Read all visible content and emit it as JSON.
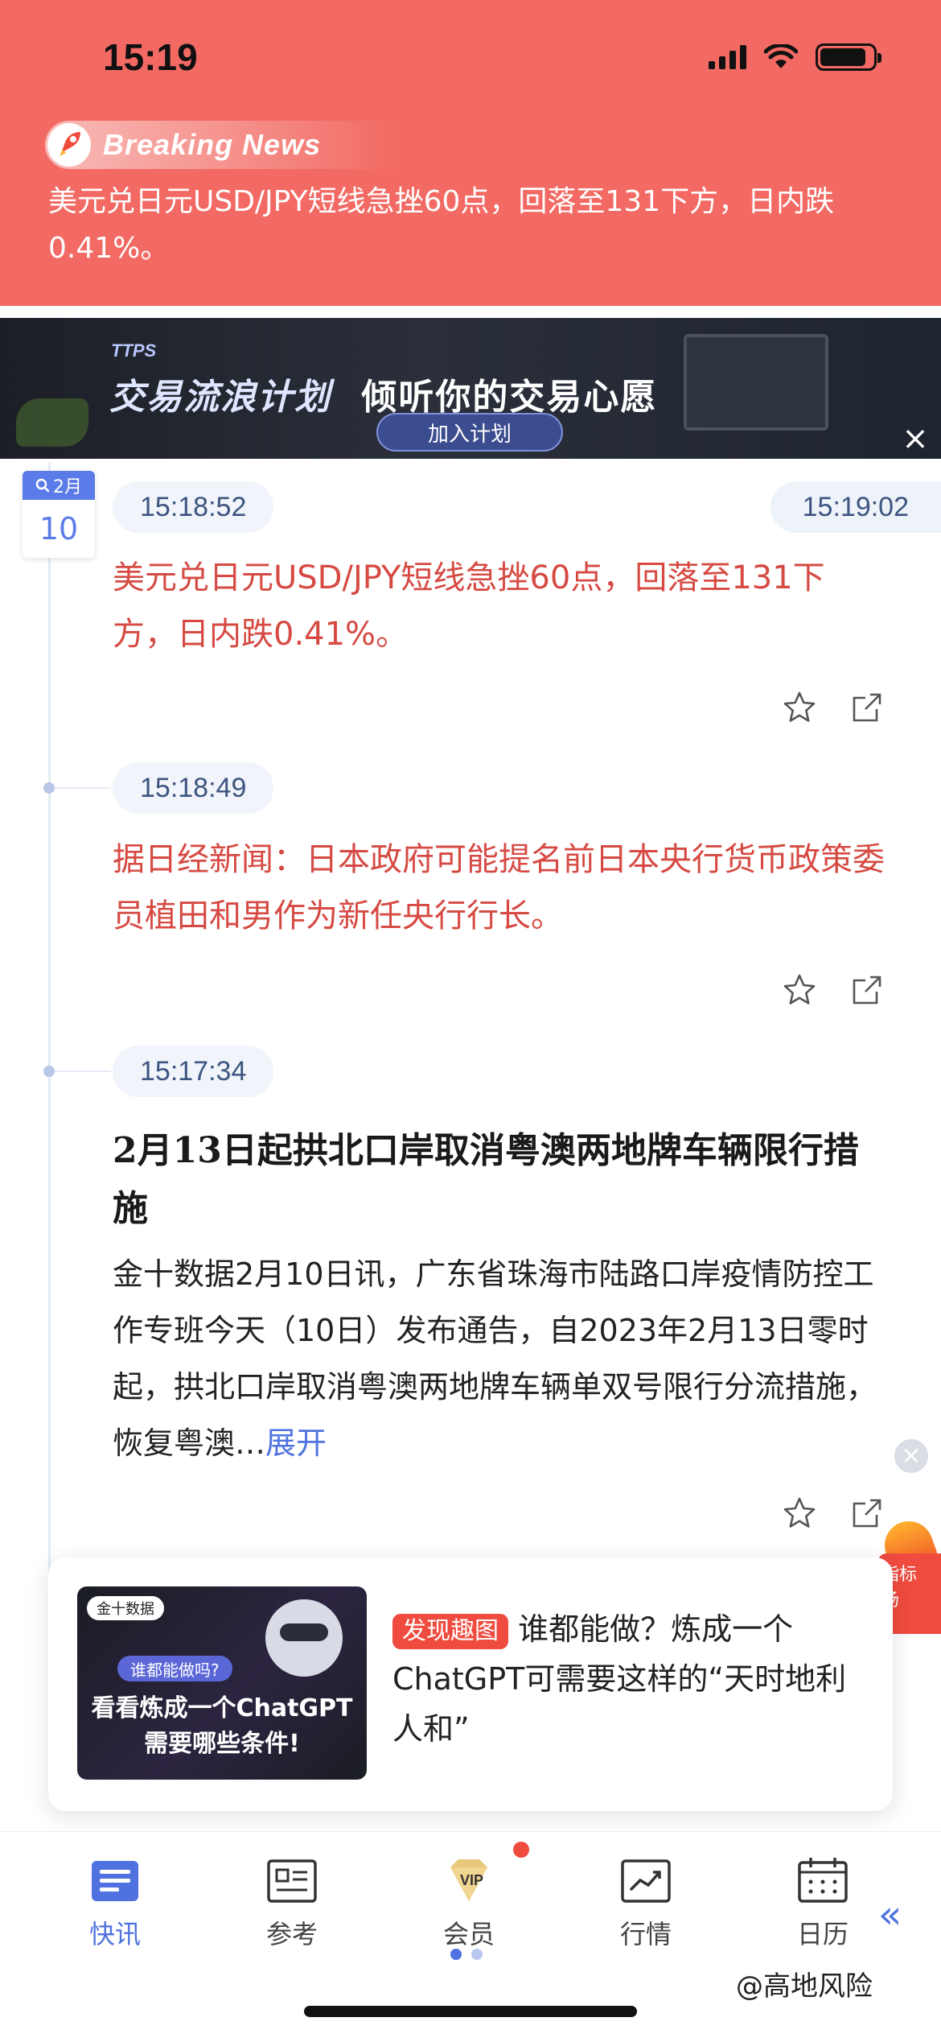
{
  "status_bar": {
    "time": "15:19"
  },
  "breaking": {
    "badge": "Breaking News",
    "text": "美元兑日元USD/JPY短线急挫60点，回落至131下方，日内跌0.41%。"
  },
  "ad": {
    "sub": "TTPS",
    "title_1": "交易流浪计划",
    "title_2": "倾听你的交易心愿",
    "cta": "加入计划",
    "close": "×"
  },
  "date_badge": {
    "month": "2月",
    "day": "10"
  },
  "feed": {
    "latest_time": "15:19:02",
    "items": [
      {
        "time": "15:18:52",
        "text": "美元兑日元USD/JPY短线急挫60点，回落至131下方，日内跌0.41%。"
      },
      {
        "time": "15:18:49",
        "text": "据日经新闻：日本政府可能提名前日本央行货币政策委员植田和男作为新任央行行长。"
      },
      {
        "time": "15:17:34",
        "title": "2月13日起拱北口岸取消粤澳两地牌车辆限行措施",
        "body": "金十数据2月10日讯，广东省珠海市陆路口岸疫情防控工作专班今天（10日）发布通告，自2023年2月13日零时起，拱北口岸取消粤澳两地牌车辆单双号限行分流措施，恢复粤澳…",
        "expand": "展开"
      }
    ]
  },
  "promo": {
    "thumb_brand": "金十数据",
    "thumb_question": "谁都能做吗?",
    "thumb_line1": "看看炼成一个ChatGPT",
    "thumb_line2": "需要哪些条件!",
    "tag": "发现趣图",
    "text": "谁都能做？炼成一个ChatGPT可需要这样的“天时地利人和”"
  },
  "side_hot": {
    "label": "指标 场"
  },
  "tabs": [
    {
      "label": "快讯",
      "icon": "news-list-icon",
      "active": true
    },
    {
      "label": "参考",
      "icon": "reference-card-icon",
      "active": false
    },
    {
      "label": "会员",
      "icon": "vip-diamond-icon",
      "active": false
    },
    {
      "label": "行情",
      "icon": "market-chart-icon",
      "active": false
    },
    {
      "label": "日历",
      "icon": "calendar-icon",
      "active": false
    }
  ],
  "watermark": "@高地风险",
  "colors": {
    "accent": "#4f72e0",
    "breaking_bg": "#f26a63",
    "news_red": "#d64a43"
  }
}
